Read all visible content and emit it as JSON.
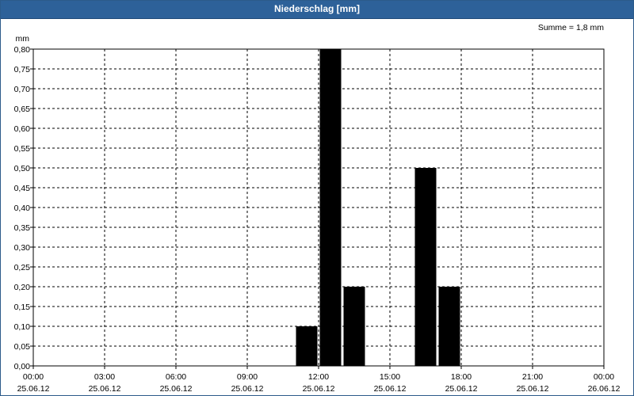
{
  "window": {
    "title": "Niederschlag [mm]"
  },
  "chart_data": {
    "type": "bar",
    "title": "Niederschlag [mm]",
    "ylabel": "mm",
    "xlabel": "",
    "annotation": "Summe = 1,8 mm",
    "ylim": [
      0,
      0.8
    ],
    "yticks": [
      "0,00",
      "0,05",
      "0,10",
      "0,15",
      "0,20",
      "0,25",
      "0,30",
      "0,35",
      "0,40",
      "0,45",
      "0,50",
      "0,55",
      "0,60",
      "0,65",
      "0,70",
      "0,75",
      "0,80"
    ],
    "xlim_hours": [
      0,
      24
    ],
    "xticks": [
      {
        "time": "00:00",
        "date": "25.06.12"
      },
      {
        "time": "03:00",
        "date": "25.06.12"
      },
      {
        "time": "06:00",
        "date": "25.06.12"
      },
      {
        "time": "09:00",
        "date": "25.06.12"
      },
      {
        "time": "12:00",
        "date": "25.06.12"
      },
      {
        "time": "15:00",
        "date": "25.06.12"
      },
      {
        "time": "18:00",
        "date": "25.06.12"
      },
      {
        "time": "21:00",
        "date": "25.06.12"
      },
      {
        "time": "00:00",
        "date": "26.06.12"
      }
    ],
    "grid": true,
    "bars": [
      {
        "start": "11:00",
        "end": "12:00",
        "value": 0.1
      },
      {
        "start": "12:00",
        "end": "13:00",
        "value": 0.8
      },
      {
        "start": "13:00",
        "end": "14:00",
        "value": 0.2
      },
      {
        "start": "16:00",
        "end": "17:00",
        "value": 0.5
      },
      {
        "start": "17:00",
        "end": "18:00",
        "value": 0.2
      }
    ],
    "bar_color": "#000000"
  }
}
